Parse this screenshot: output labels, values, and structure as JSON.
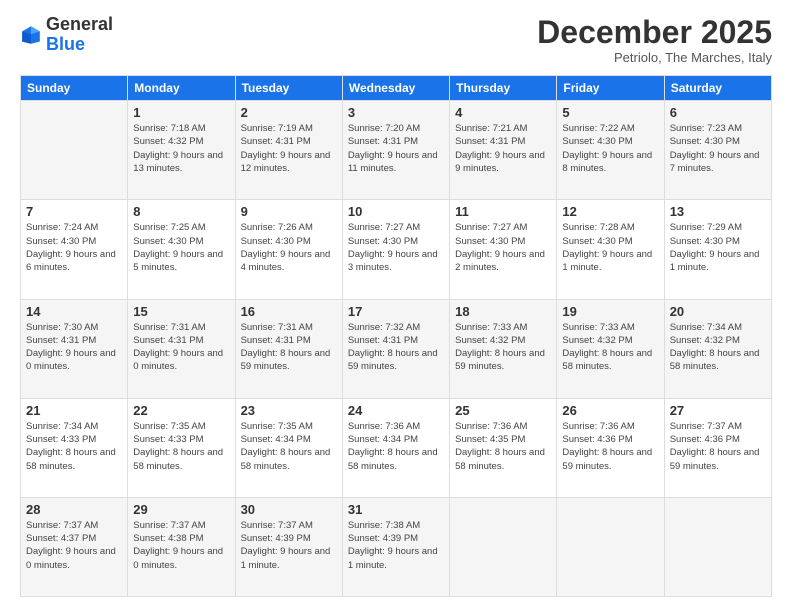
{
  "logo": {
    "general": "General",
    "blue": "Blue"
  },
  "title": "December 2025",
  "location": "Petriolo, The Marches, Italy",
  "weekdays": [
    "Sunday",
    "Monday",
    "Tuesday",
    "Wednesday",
    "Thursday",
    "Friday",
    "Saturday"
  ],
  "weeks": [
    [
      {
        "day": "",
        "sunrise": "",
        "sunset": "",
        "daylight": ""
      },
      {
        "day": "1",
        "sunrise": "Sunrise: 7:18 AM",
        "sunset": "Sunset: 4:32 PM",
        "daylight": "Daylight: 9 hours and 13 minutes."
      },
      {
        "day": "2",
        "sunrise": "Sunrise: 7:19 AM",
        "sunset": "Sunset: 4:31 PM",
        "daylight": "Daylight: 9 hours and 12 minutes."
      },
      {
        "day": "3",
        "sunrise": "Sunrise: 7:20 AM",
        "sunset": "Sunset: 4:31 PM",
        "daylight": "Daylight: 9 hours and 11 minutes."
      },
      {
        "day": "4",
        "sunrise": "Sunrise: 7:21 AM",
        "sunset": "Sunset: 4:31 PM",
        "daylight": "Daylight: 9 hours and 9 minutes."
      },
      {
        "day": "5",
        "sunrise": "Sunrise: 7:22 AM",
        "sunset": "Sunset: 4:30 PM",
        "daylight": "Daylight: 9 hours and 8 minutes."
      },
      {
        "day": "6",
        "sunrise": "Sunrise: 7:23 AM",
        "sunset": "Sunset: 4:30 PM",
        "daylight": "Daylight: 9 hours and 7 minutes."
      }
    ],
    [
      {
        "day": "7",
        "sunrise": "Sunrise: 7:24 AM",
        "sunset": "Sunset: 4:30 PM",
        "daylight": "Daylight: 9 hours and 6 minutes."
      },
      {
        "day": "8",
        "sunrise": "Sunrise: 7:25 AM",
        "sunset": "Sunset: 4:30 PM",
        "daylight": "Daylight: 9 hours and 5 minutes."
      },
      {
        "day": "9",
        "sunrise": "Sunrise: 7:26 AM",
        "sunset": "Sunset: 4:30 PM",
        "daylight": "Daylight: 9 hours and 4 minutes."
      },
      {
        "day": "10",
        "sunrise": "Sunrise: 7:27 AM",
        "sunset": "Sunset: 4:30 PM",
        "daylight": "Daylight: 9 hours and 3 minutes."
      },
      {
        "day": "11",
        "sunrise": "Sunrise: 7:27 AM",
        "sunset": "Sunset: 4:30 PM",
        "daylight": "Daylight: 9 hours and 2 minutes."
      },
      {
        "day": "12",
        "sunrise": "Sunrise: 7:28 AM",
        "sunset": "Sunset: 4:30 PM",
        "daylight": "Daylight: 9 hours and 1 minute."
      },
      {
        "day": "13",
        "sunrise": "Sunrise: 7:29 AM",
        "sunset": "Sunset: 4:30 PM",
        "daylight": "Daylight: 9 hours and 1 minute."
      }
    ],
    [
      {
        "day": "14",
        "sunrise": "Sunrise: 7:30 AM",
        "sunset": "Sunset: 4:31 PM",
        "daylight": "Daylight: 9 hours and 0 minutes."
      },
      {
        "day": "15",
        "sunrise": "Sunrise: 7:31 AM",
        "sunset": "Sunset: 4:31 PM",
        "daylight": "Daylight: 9 hours and 0 minutes."
      },
      {
        "day": "16",
        "sunrise": "Sunrise: 7:31 AM",
        "sunset": "Sunset: 4:31 PM",
        "daylight": "Daylight: 8 hours and 59 minutes."
      },
      {
        "day": "17",
        "sunrise": "Sunrise: 7:32 AM",
        "sunset": "Sunset: 4:31 PM",
        "daylight": "Daylight: 8 hours and 59 minutes."
      },
      {
        "day": "18",
        "sunrise": "Sunrise: 7:33 AM",
        "sunset": "Sunset: 4:32 PM",
        "daylight": "Daylight: 8 hours and 59 minutes."
      },
      {
        "day": "19",
        "sunrise": "Sunrise: 7:33 AM",
        "sunset": "Sunset: 4:32 PM",
        "daylight": "Daylight: 8 hours and 58 minutes."
      },
      {
        "day": "20",
        "sunrise": "Sunrise: 7:34 AM",
        "sunset": "Sunset: 4:32 PM",
        "daylight": "Daylight: 8 hours and 58 minutes."
      }
    ],
    [
      {
        "day": "21",
        "sunrise": "Sunrise: 7:34 AM",
        "sunset": "Sunset: 4:33 PM",
        "daylight": "Daylight: 8 hours and 58 minutes."
      },
      {
        "day": "22",
        "sunrise": "Sunrise: 7:35 AM",
        "sunset": "Sunset: 4:33 PM",
        "daylight": "Daylight: 8 hours and 58 minutes."
      },
      {
        "day": "23",
        "sunrise": "Sunrise: 7:35 AM",
        "sunset": "Sunset: 4:34 PM",
        "daylight": "Daylight: 8 hours and 58 minutes."
      },
      {
        "day": "24",
        "sunrise": "Sunrise: 7:36 AM",
        "sunset": "Sunset: 4:34 PM",
        "daylight": "Daylight: 8 hours and 58 minutes."
      },
      {
        "day": "25",
        "sunrise": "Sunrise: 7:36 AM",
        "sunset": "Sunset: 4:35 PM",
        "daylight": "Daylight: 8 hours and 58 minutes."
      },
      {
        "day": "26",
        "sunrise": "Sunrise: 7:36 AM",
        "sunset": "Sunset: 4:36 PM",
        "daylight": "Daylight: 8 hours and 59 minutes."
      },
      {
        "day": "27",
        "sunrise": "Sunrise: 7:37 AM",
        "sunset": "Sunset: 4:36 PM",
        "daylight": "Daylight: 8 hours and 59 minutes."
      }
    ],
    [
      {
        "day": "28",
        "sunrise": "Sunrise: 7:37 AM",
        "sunset": "Sunset: 4:37 PM",
        "daylight": "Daylight: 9 hours and 0 minutes."
      },
      {
        "day": "29",
        "sunrise": "Sunrise: 7:37 AM",
        "sunset": "Sunset: 4:38 PM",
        "daylight": "Daylight: 9 hours and 0 minutes."
      },
      {
        "day": "30",
        "sunrise": "Sunrise: 7:37 AM",
        "sunset": "Sunset: 4:39 PM",
        "daylight": "Daylight: 9 hours and 1 minute."
      },
      {
        "day": "31",
        "sunrise": "Sunrise: 7:38 AM",
        "sunset": "Sunset: 4:39 PM",
        "daylight": "Daylight: 9 hours and 1 minute."
      },
      {
        "day": "",
        "sunrise": "",
        "sunset": "",
        "daylight": ""
      },
      {
        "day": "",
        "sunrise": "",
        "sunset": "",
        "daylight": ""
      },
      {
        "day": "",
        "sunrise": "",
        "sunset": "",
        "daylight": ""
      }
    ]
  ]
}
